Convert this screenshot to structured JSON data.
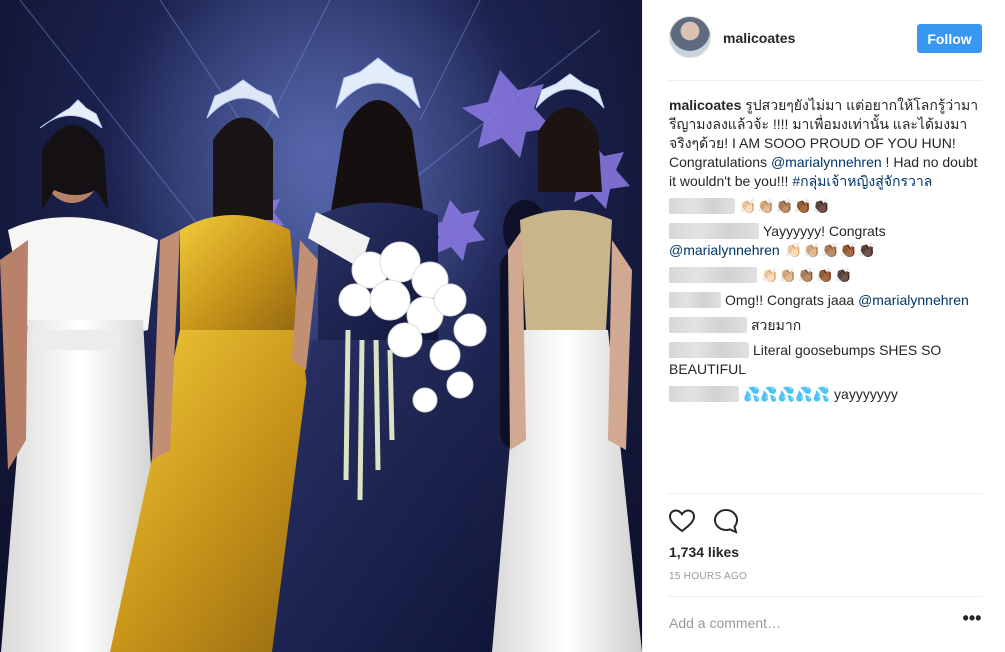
{
  "post": {
    "username": "malicoates",
    "follow_label": "Follow"
  },
  "caption": {
    "username": "malicoates",
    "text_1": "รูปสวยๆยังไม่มา แต่อยากให้โลกรู้ว่ามารีญามงลงแล้วจ้ะ !!!! มาเพื่อมงเท่านั้น และได้มงมาจริงๆด้วย! I AM SOOO PROUD OF YOU HUN! Congratulations ",
    "mention": "@marialynnehren",
    "text_2": " ! Had no doubt it wouldn't be you!!! ",
    "hashtag": "#กลุ่มเจ้าหญิงสู่จักรวาล"
  },
  "comments": [
    {
      "text": "👏🏻👏🏼👏🏽👏🏾👏🏿"
    },
    {
      "text": "Yayyyyyy! Congrats ",
      "mention": "@marialynnehren",
      "emoji": " 👏🏻👏🏼👏🏽👏🏾👏🏿"
    },
    {
      "text": "👏🏻👏🏼👏🏽👏🏾👏🏿"
    },
    {
      "text": "Omg!! Congrats jaaa ",
      "mention": "@marialynnehren"
    },
    {
      "text": "สวยมาก"
    },
    {
      "text": "Literal goosebumps SHES SO BEAUTIFUL"
    },
    {
      "text": "💦💦💦💦💦 yayyyyyyy"
    }
  ],
  "stats": {
    "likes": "1,734 likes",
    "time": "15 HOURS AGO"
  },
  "comment_box": {
    "placeholder": "Add a comment…",
    "more_label": "•••"
  },
  "colors": {
    "follow_bg": "#3897f0",
    "link": "#003569"
  },
  "icons": [
    "heart-icon",
    "comment-icon",
    "more-options-icon"
  ]
}
